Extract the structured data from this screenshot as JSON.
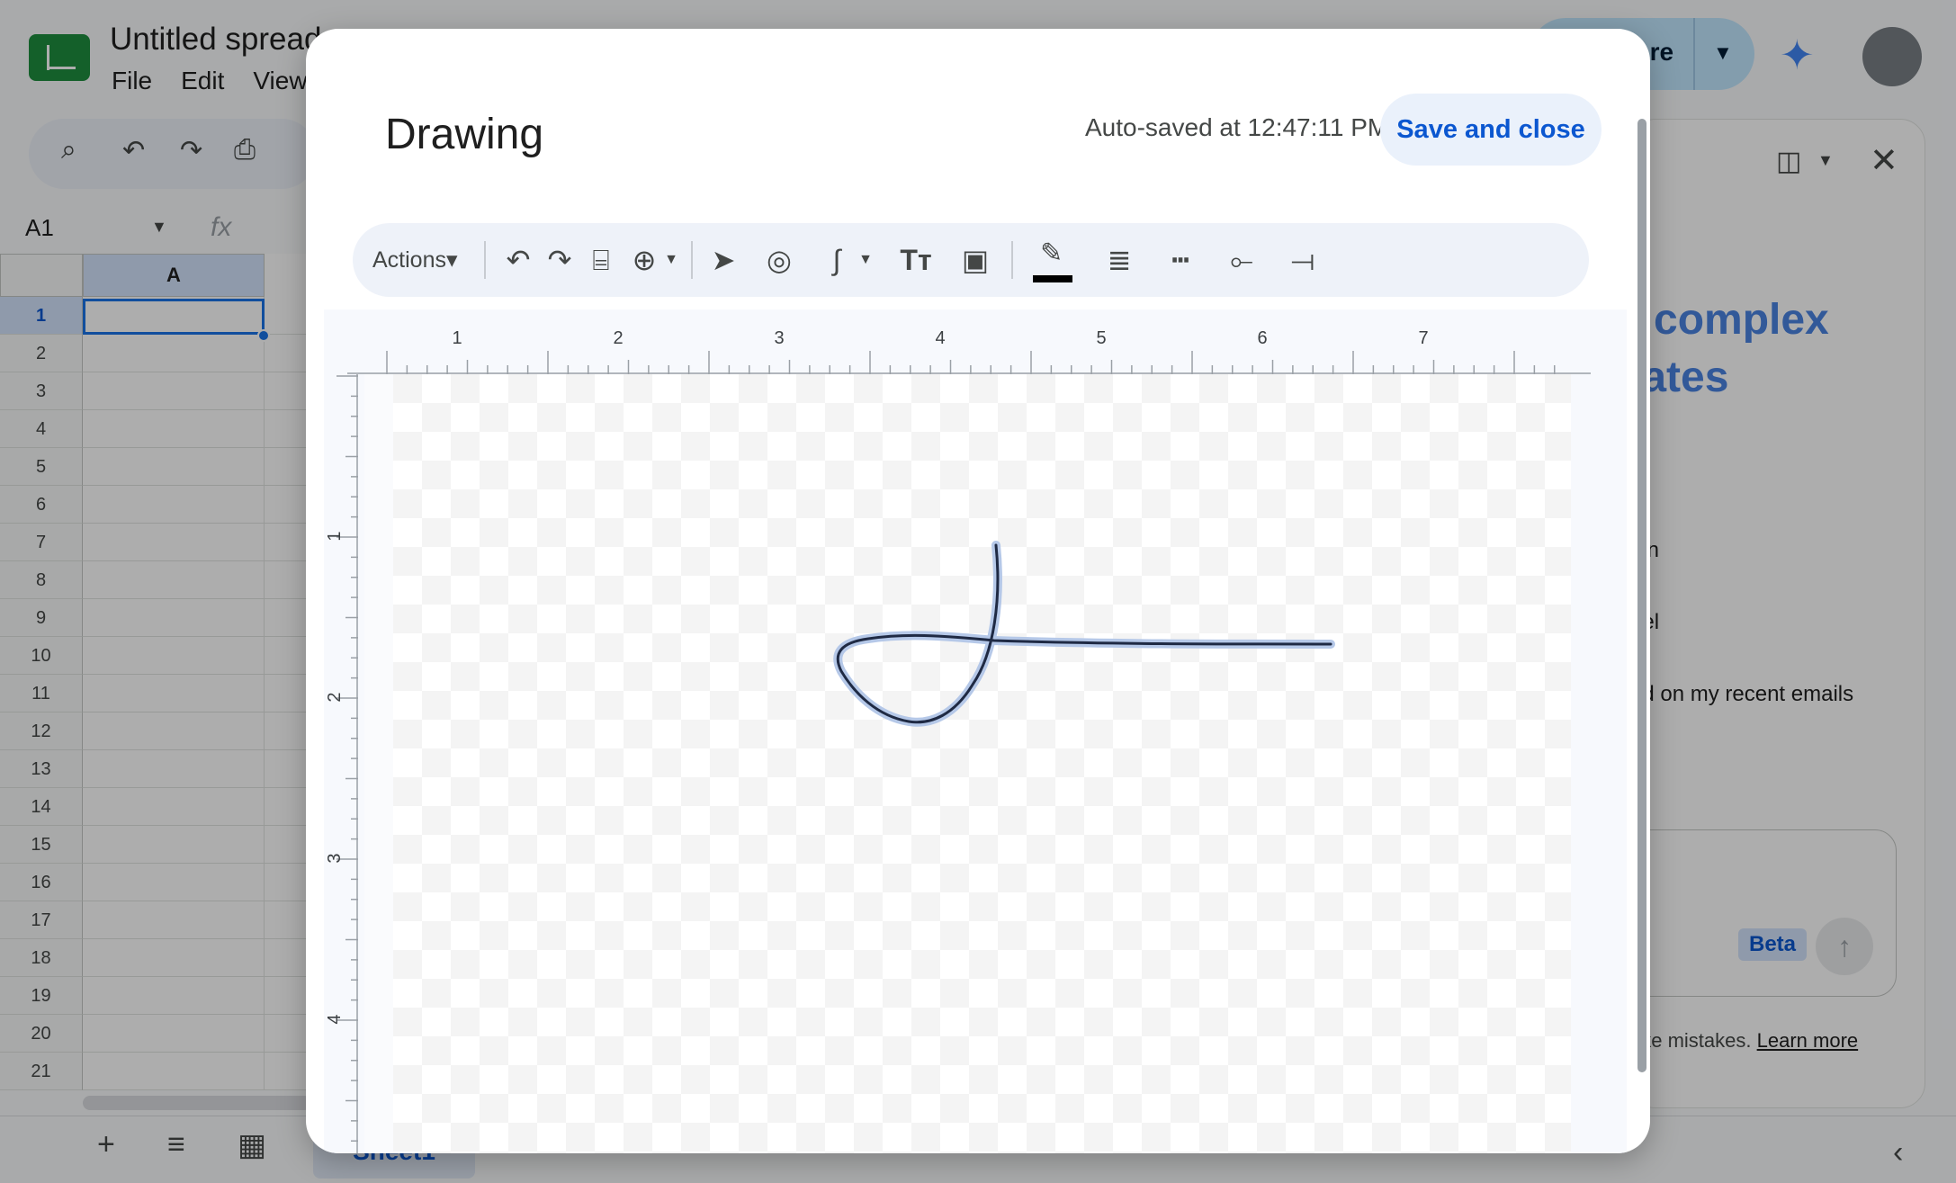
{
  "app": {
    "doc_title": "Untitled spread",
    "menus": [
      "File",
      "Edit",
      "View"
    ],
    "share_label": "are",
    "name_box": "A1",
    "formula_icon": "fx",
    "column_header": "A",
    "rows": [
      "1",
      "2",
      "3",
      "4",
      "5",
      "6",
      "7",
      "8",
      "9",
      "10",
      "11",
      "12",
      "13",
      "14",
      "15",
      "16",
      "17",
      "18",
      "19",
      "20",
      "21"
    ],
    "sheet_tab": "Sheet1"
  },
  "side_panel": {
    "hero_line1": "complex",
    "hero_line2": "lates",
    "suggestions": [
      "ion",
      "del",
      "ed on my recent emails"
    ],
    "beta": "Beta",
    "disclaimer_text": "ake mistakes.",
    "learn_more": "Learn more"
  },
  "dialog": {
    "title": "Drawing",
    "autosave": "Auto-saved at 12:47:11 PM",
    "save_close": "Save and close",
    "toolbar": {
      "actions": "Actions",
      "actions_caret": "▾",
      "icons": [
        "undo-icon",
        "redo-icon",
        "paint-format-icon",
        "zoom-icon",
        "select-icon",
        "shape-icon",
        "scribble-icon",
        "text-icon",
        "image-icon",
        "pen-color-icon",
        "line-weight-icon",
        "line-dash-icon",
        "line-start-icon",
        "line-end-icon"
      ],
      "pen_color": "#000000"
    },
    "ruler": {
      "horizontal": [
        "1",
        "2",
        "3",
        "4",
        "5",
        "6",
        "7"
      ],
      "vertical": [
        "1",
        "2",
        "3",
        "4"
      ]
    },
    "stroke_color": "#1f2a44",
    "stroke_highlight": "#b5c8e8"
  }
}
